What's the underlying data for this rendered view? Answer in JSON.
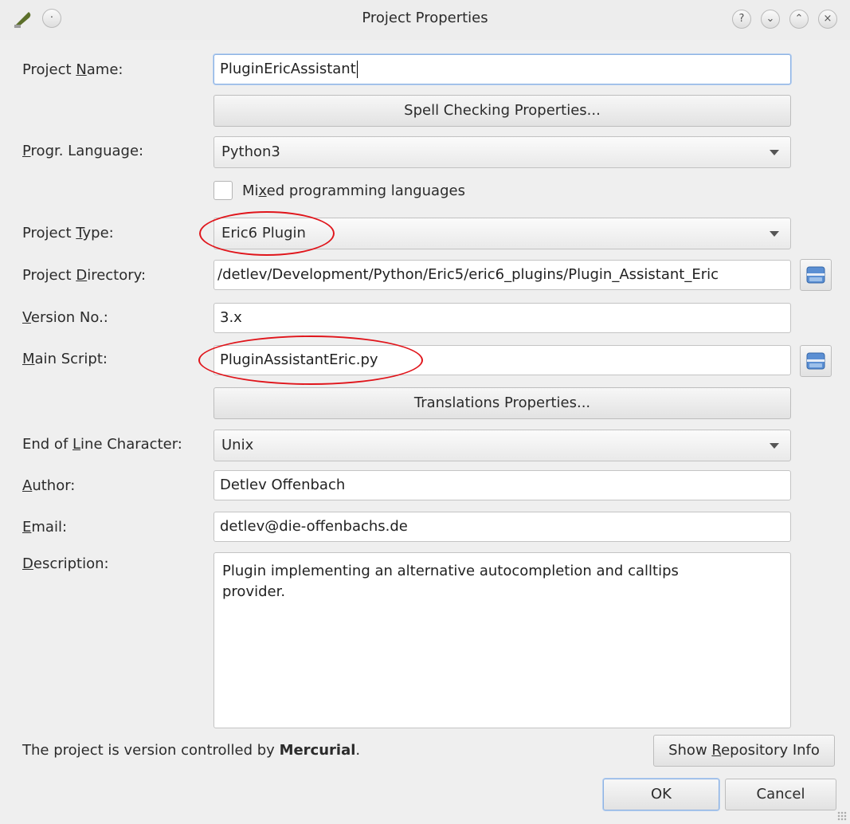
{
  "window": {
    "title": "Project Properties",
    "app_icon": "eric-quill-icon",
    "controls": {
      "help": "?",
      "minimize": "⌄",
      "maximize": "⌃",
      "close": "×"
    }
  },
  "form": {
    "project_name": {
      "label_pre": "Project ",
      "label_key": "N",
      "label_post": "ame:",
      "value": "PluginEricAssistant"
    },
    "spell_checking_button": "Spell Checking Properties...",
    "language": {
      "label_pre": "",
      "label_key": "P",
      "label_post": "rogr. Language:",
      "value": "Python3"
    },
    "mixed_languages": {
      "label_pre": "Mi",
      "label_key": "x",
      "label_post": "ed programming languages",
      "checked": false
    },
    "project_type": {
      "label_pre": "Project ",
      "label_key": "T",
      "label_post": "ype:",
      "value": "Eric6 Plugin"
    },
    "project_directory": {
      "label_pre": "Project ",
      "label_key": "D",
      "label_post": "irectory:",
      "value": "/detlev/Development/Python/Eric5/eric6_plugins/Plugin_Assistant_Eric"
    },
    "version": {
      "label_pre": "",
      "label_key": "V",
      "label_post": "ersion No.:",
      "value": "3.x"
    },
    "main_script": {
      "label_pre": "",
      "label_key": "M",
      "label_post": "ain Script:",
      "value": "PluginAssistantEric.py"
    },
    "translations_button": "Translations Properties...",
    "eol": {
      "label_pre": "End of ",
      "label_key": "L",
      "label_post": "ine Character:",
      "value": "Unix"
    },
    "author": {
      "label_pre": "",
      "label_key": "A",
      "label_post": "uthor:",
      "value": "Detlev Offenbach"
    },
    "email": {
      "label_pre": "",
      "label_key": "E",
      "label_post": "mail:",
      "value": "detlev@die-offenbachs.de"
    },
    "description": {
      "label_pre": "",
      "label_key": "D",
      "label_post": "escription:",
      "value": "Plugin implementing an alternative autocompletion and calltips\nprovider."
    }
  },
  "vcs": {
    "text_pre": "The project is version controlled by ",
    "vcs_name": "Mercurial",
    "text_post": ".",
    "repo_button_pre": "Show ",
    "repo_button_key": "R",
    "repo_button_post": "epository Info"
  },
  "buttons": {
    "ok": "OK",
    "cancel": "Cancel"
  },
  "colors": {
    "highlight_ellipse": "#e0151b",
    "focus": "#8db2e3"
  }
}
